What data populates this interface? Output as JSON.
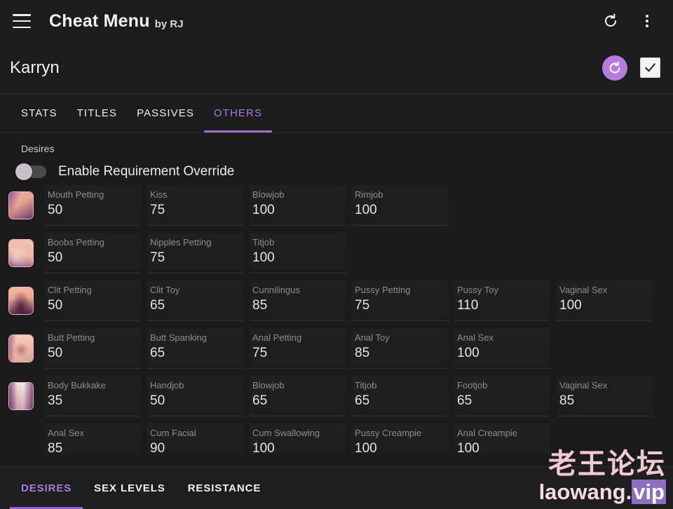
{
  "appbar": {
    "menu_icon": "hamburger-menu-icon",
    "title": "Cheat Menu",
    "subtitle": "by RJ",
    "refresh_icon": "refresh-icon",
    "overflow_icon": "more-vertical-icon"
  },
  "character": {
    "name": "Karryn",
    "reset_icon": "refresh-circle-icon",
    "check_icon": "checkmark-icon"
  },
  "tabs": [
    {
      "label": "STATS",
      "active": false
    },
    {
      "label": "TITLES",
      "active": false
    },
    {
      "label": "PASSIVES",
      "active": false
    },
    {
      "label": "OTHERS",
      "active": true
    }
  ],
  "section": {
    "label": "Desires",
    "toggle_label": "Enable Requirement Override",
    "toggle_on": false
  },
  "rows": [
    {
      "thumb": "mouth-thumbnail",
      "cells": [
        {
          "label": "Mouth Petting",
          "value": "50"
        },
        {
          "label": "Kiss",
          "value": "75"
        },
        {
          "label": "Blowjob",
          "value": "100"
        },
        {
          "label": "Rimjob",
          "value": "100"
        }
      ]
    },
    {
      "thumb": "breasts-thumbnail",
      "cells": [
        {
          "label": "Boobs Petting",
          "value": "50"
        },
        {
          "label": "Nipples Petting",
          "value": "75"
        },
        {
          "label": "Titjob",
          "value": "100"
        }
      ]
    },
    {
      "thumb": "pussy-thumbnail",
      "cells": [
        {
          "label": "Clit Petting",
          "value": "50"
        },
        {
          "label": "Clit Toy",
          "value": "65"
        },
        {
          "label": "Cunnilingus",
          "value": "85"
        },
        {
          "label": "Pussy Petting",
          "value": "75"
        },
        {
          "label": "Pussy Toy",
          "value": "110"
        },
        {
          "label": "Vaginal Sex",
          "value": "100"
        }
      ]
    },
    {
      "thumb": "butt-thumbnail",
      "cells": [
        {
          "label": "Butt Petting",
          "value": "50"
        },
        {
          "label": "Butt Spanking",
          "value": "65"
        },
        {
          "label": "Anal Petting",
          "value": "75"
        },
        {
          "label": "Anal Toy",
          "value": "85"
        },
        {
          "label": "Anal Sex",
          "value": "100"
        }
      ]
    },
    {
      "thumb": "body-thumbnail",
      "cells": [
        {
          "label": "Body Bukkake",
          "value": "35"
        },
        {
          "label": "Handjob",
          "value": "50"
        },
        {
          "label": "Blowjob",
          "value": "65"
        },
        {
          "label": "Titjob",
          "value": "65"
        },
        {
          "label": "Footjob",
          "value": "65"
        },
        {
          "label": "Vaginal Sex",
          "value": "85"
        }
      ]
    },
    {
      "thumb": "",
      "cells": [
        {
          "label": "Anal Sex",
          "value": "85"
        },
        {
          "label": "Cum Facial",
          "value": "90"
        },
        {
          "label": "Cum Swallowing",
          "value": "100"
        },
        {
          "label": "Pussy Creampie",
          "value": "100"
        },
        {
          "label": "Anal Creampie",
          "value": "100"
        }
      ]
    }
  ],
  "bottom_tabs": [
    {
      "label": "DESIRES",
      "active": true
    },
    {
      "label": "SEX LEVELS",
      "active": false
    },
    {
      "label": "RESISTANCE",
      "active": false
    }
  ],
  "watermark": {
    "cn": "老王论坛",
    "en_main": "laowang",
    "en_dot": ".",
    "en_tld": "vip"
  },
  "colors": {
    "accent": "#a77ee0",
    "accent_fab": "#b87ce0",
    "background": "#1b1b1b",
    "surface": "#1c1c1c"
  }
}
